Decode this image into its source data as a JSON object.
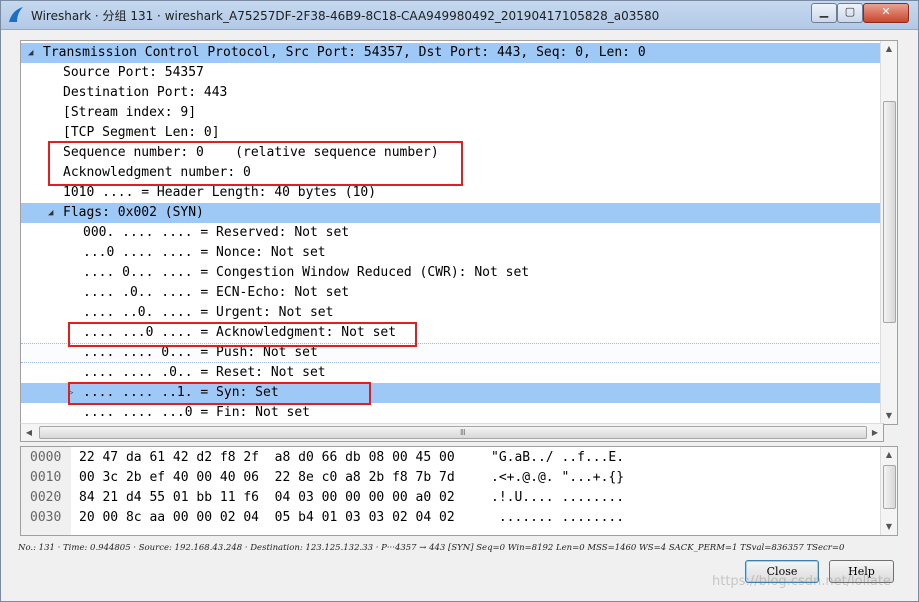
{
  "window": {
    "title": "Wireshark · 分组 131 · wireshark_A75257DF-2F38-46B9-8C18-CAA949980492_20190417105828_a03580",
    "min_glyph": "▁",
    "max_glyph": "▢",
    "close_glyph": "✕"
  },
  "tree": {
    "rows": [
      {
        "text": "Transmission Control Protocol, Src Port: 54357, Dst Port: 443, Seq: 0, Len: 0",
        "indent": 0,
        "expander": "◢",
        "selected": true
      },
      {
        "text": "Source Port: 54357",
        "indent": 1
      },
      {
        "text": "Destination Port: 443",
        "indent": 1
      },
      {
        "text": "[Stream index: 9]",
        "indent": 1
      },
      {
        "text": "[TCP Segment Len: 0]",
        "indent": 1
      },
      {
        "text": "Sequence number: 0    (relative sequence number)",
        "indent": 1
      },
      {
        "text": "Acknowledgment number: 0",
        "indent": 1
      },
      {
        "text": "1010 .... = Header Length: 40 bytes (10)",
        "indent": 1
      },
      {
        "text": "Flags: 0x002 (SYN)",
        "indent": 1,
        "expander": "◢",
        "selected": true
      },
      {
        "text": "000. .... .... = Reserved: Not set",
        "indent": 2
      },
      {
        "text": "...0 .... .... = Nonce: Not set",
        "indent": 2
      },
      {
        "text": ".... 0... .... = Congestion Window Reduced (CWR): Not set",
        "indent": 2
      },
      {
        "text": ".... .0.. .... = ECN-Echo: Not set",
        "indent": 2
      },
      {
        "text": ".... ..0. .... = Urgent: Not set",
        "indent": 2
      },
      {
        "text": ".... ...0 .... = Acknowledgment: Not set",
        "indent": 2
      },
      {
        "text": ".... .... 0... = Push: Not set",
        "indent": 2,
        "hover": true
      },
      {
        "text": ".... .... .0.. = Reset: Not set",
        "indent": 2
      },
      {
        "text": ".... .... ..1. = Syn: Set",
        "indent": 2,
        "expander": "▷",
        "selected": true
      },
      {
        "text": ".... .... ...0 = Fin: Not set",
        "indent": 2
      }
    ],
    "scroll_up": "▲",
    "scroll_down": "▼",
    "scroll_left": "◀",
    "scroll_right": "▶",
    "grip": "Ⅲ"
  },
  "hex": {
    "rows": [
      {
        "offset": "0000",
        "bytes": "22 47 da 61 42 d2 f8 2f  a8 d0 66 db 08 00 45 00",
        "ascii": "\"G.aB../ ..f...E."
      },
      {
        "offset": "0010",
        "bytes": "00 3c 2b ef 40 00 40 06  22 8e c0 a8 2b f8 7b 7d",
        "ascii": ".<+.@.@. \"...+.{}"
      },
      {
        "offset": "0020",
        "bytes": "84 21 d4 55 01 bb 11 f6  04 03 00 00 00 00 a0 02",
        "ascii": ".!.U.... ........"
      },
      {
        "offset": "0030",
        "bytes": "20 00 8c aa 00 00 02 04  05 b4 01 03 03 02 04 02",
        "ascii": " ....... ........"
      }
    ]
  },
  "status": "No.: 131 · Time: 0.944805 · Source: 192.168.43.248 · Destination: 123.125.132.33 · P···4357 → 443 [SYN] Seq=0 Win=8192 Len=0 MSS=1460 WS=4 SACK_PERM=1 TSval=836357 TSecr=0",
  "buttons": {
    "close": "Close",
    "help": "Help"
  },
  "watermark": "https://blog.csdn.net/lollate"
}
